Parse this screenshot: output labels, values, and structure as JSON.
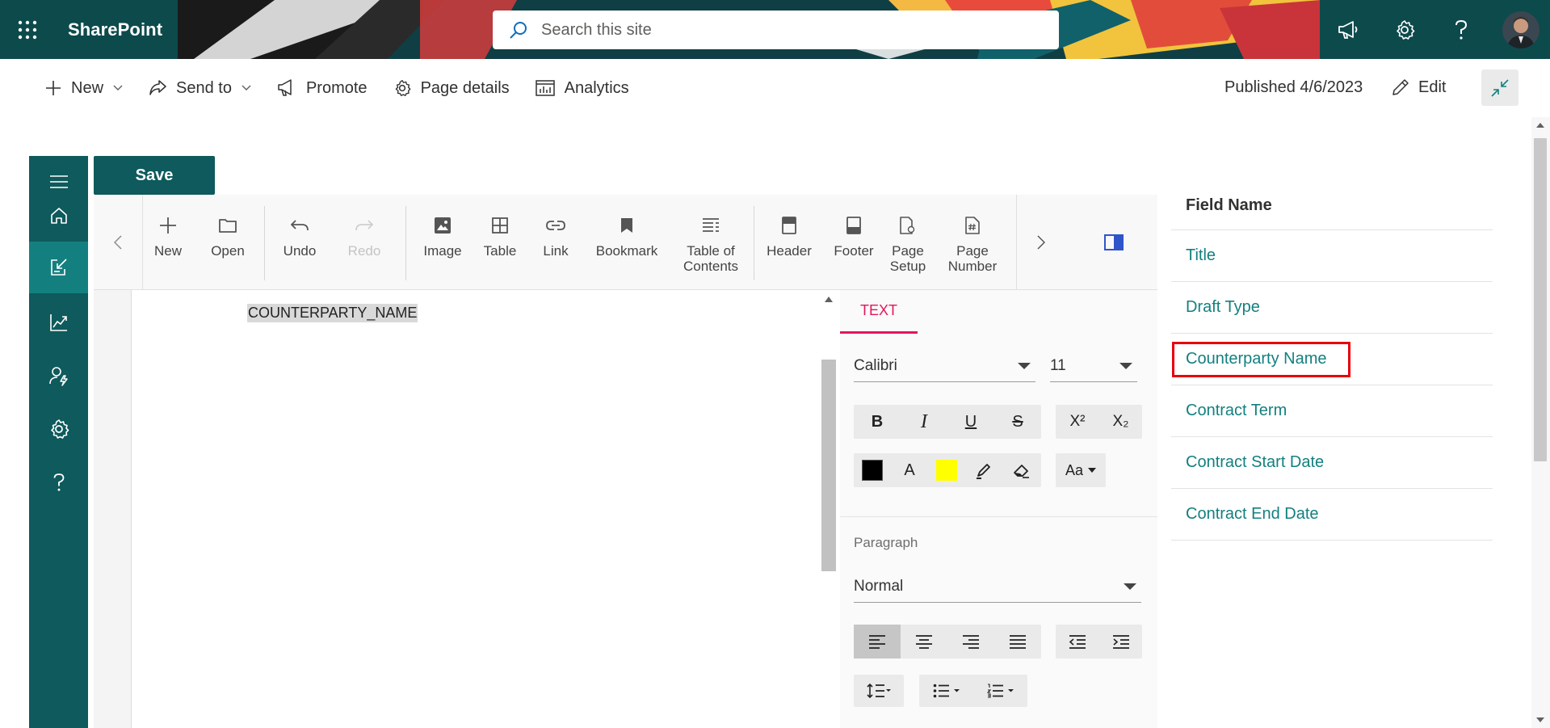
{
  "suite": {
    "brand": "SharePoint",
    "search_placeholder": "Search this site",
    "right_icons": [
      "megaphone-icon",
      "gear-icon",
      "help-icon"
    ],
    "accent": "#0d4a4c"
  },
  "command_bar": {
    "new": "New",
    "send_to": "Send to",
    "promote": "Promote",
    "page_details": "Page details",
    "analytics": "Analytics",
    "published": "Published 4/6/2023",
    "edit": "Edit"
  },
  "left_rail": {
    "icons": [
      "hamburger-icon",
      "home-icon",
      "import-icon",
      "chart-icon",
      "user-settings-icon",
      "gear-icon",
      "help-icon"
    ],
    "color": "#0e5a5c",
    "active_color": "#13807f"
  },
  "editor": {
    "save": "Save",
    "ribbon": {
      "new": "New",
      "open": "Open",
      "undo": "Undo",
      "redo": "Redo",
      "image": "Image",
      "table": "Table",
      "link": "Link",
      "bookmark": "Bookmark",
      "toc_line1": "Table of",
      "toc_line2": "Contents",
      "header": "Header",
      "footer": "Footer",
      "page_setup_line1": "Page",
      "page_setup_line2": "Setup",
      "page_number_line1": "Page",
      "page_number_line2": "Number"
    },
    "document": {
      "field_placeholder": "COUNTERPARTY_NAME"
    },
    "properties": {
      "tab": "TEXT",
      "font_family": "Calibri",
      "font_size": "11",
      "bold": "B",
      "italic": "I",
      "underline": "U",
      "strike": "S",
      "superscript": "X²",
      "subscript": "X₂",
      "font_color_letter": "A",
      "change_case": "Aa",
      "font_color": "#000000",
      "highlight_color": "#ffff00",
      "paragraph_label": "Paragraph",
      "paragraph_style": "Normal",
      "accent": "#e3165b"
    }
  },
  "field_list": {
    "header": "Field Name",
    "items": [
      "Title",
      "Draft Type",
      "Counterparty Name",
      "Contract Term",
      "Contract Start Date",
      "Contract End Date"
    ],
    "highlighted": "Counterparty Name",
    "link_color": "#13807f",
    "highlight_color": "#e8000b"
  }
}
